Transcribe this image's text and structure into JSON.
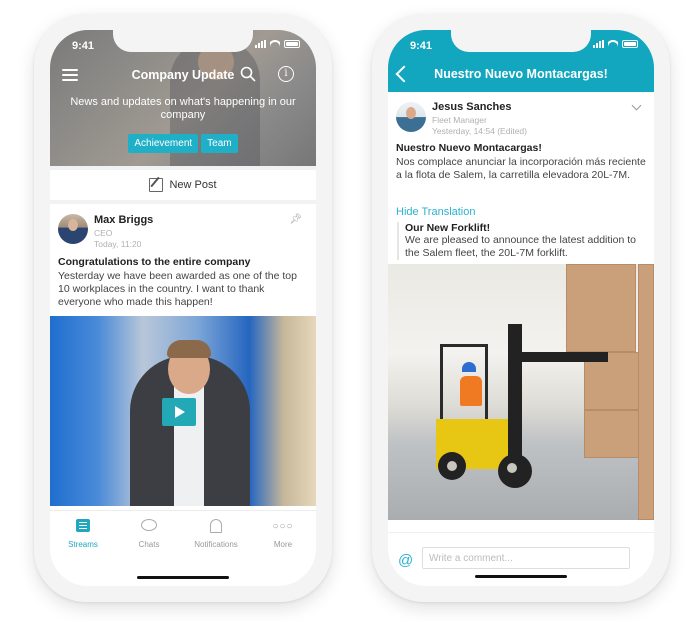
{
  "left_phone": {
    "status_bar": {
      "time": "9:41"
    },
    "header": {
      "title": "Company Update",
      "description": "News and updates on what's happening in our company",
      "tags": [
        "Achievement",
        "Team"
      ]
    },
    "new_post_label": "New Post",
    "post": {
      "author": "Max Briggs",
      "role": "CEO",
      "timestamp": "Today, 11:20",
      "title": "Congratulations to the entire company",
      "body": "Yesterday we have been awarded as one of the top 10 workplaces in the country. I want to thank everyone who made this happen!",
      "media": "video"
    },
    "tab_bar": {
      "items": [
        {
          "label": "Streams",
          "icon": "streams-icon",
          "active": true
        },
        {
          "label": "Chats",
          "icon": "chat-icon",
          "active": false
        },
        {
          "label": "Notifications",
          "icon": "bell-icon",
          "active": false
        },
        {
          "label": "More",
          "icon": "more-icon",
          "active": false
        }
      ]
    }
  },
  "right_phone": {
    "status_bar": {
      "time": "9:41"
    },
    "header": {
      "title": "Nuestro Nuevo Montacargas!"
    },
    "post": {
      "author": "Jesus  Sanches",
      "role": "Fleet Manager",
      "timestamp": "Yesterday, 14:54 (Edited)",
      "title": "Nuestro Nuevo Montacargas!",
      "body": "Nos complace anunciar la incorporación más reciente a la flota de Salem, la carretilla elevadora 20L-7M.",
      "translation_toggle": "Hide Translation",
      "translation": {
        "title": "Our New Forklift!",
        "body": "We are pleased to announce the latest addition to the Salem fleet, the 20L-7M forklift."
      },
      "media": "image"
    },
    "comment": {
      "placeholder": "Write a comment...",
      "value": ""
    }
  },
  "colors": {
    "accent": "#12a6bf",
    "tag": "#1fb0c8",
    "link": "#2bb3cf"
  }
}
